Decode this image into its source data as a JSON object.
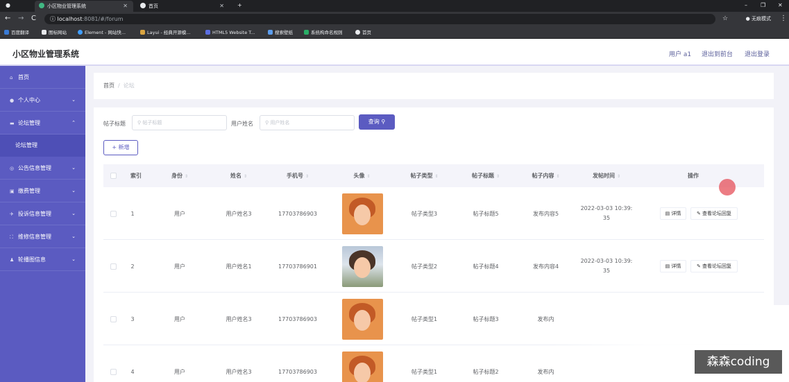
{
  "browser": {
    "tabs": [
      {
        "title": "小区物业管理系统",
        "active": true
      },
      {
        "title": "首页",
        "active": false
      }
    ],
    "url_host": "localhost",
    "url_rest": ":8081/#/forum",
    "incognito_label": "无痕模式",
    "bookmarks": [
      "百度翻译",
      "图标网站",
      "Element - 网站快...",
      "Layui - 经典开源模...",
      "HTML5 Website T...",
      "搜索壁纸",
      "系统构命名规则",
      "首页"
    ]
  },
  "header": {
    "title": "小区物业管理系统",
    "user_label": "用户 a1",
    "to_front_label": "退出到前台",
    "logout_label": "退出登录"
  },
  "sidebar": {
    "items": [
      {
        "label": "首页",
        "icon": "home-icon",
        "arrow": ""
      },
      {
        "label": "个人中心",
        "icon": "user-icon",
        "arrow": "⌄"
      },
      {
        "label": "论坛管理",
        "icon": "chat-icon",
        "arrow": "⌃"
      },
      {
        "label": "公告信息管理",
        "icon": "notice-icon",
        "arrow": "⌄"
      },
      {
        "label": "缴费管理",
        "icon": "payment-icon",
        "arrow": "⌄"
      },
      {
        "label": "投诉信息管理",
        "icon": "complaint-icon",
        "arrow": "⌄"
      },
      {
        "label": "维修信息管理",
        "icon": "repair-icon",
        "arrow": "⌄"
      },
      {
        "label": "轮播图信息",
        "icon": "carousel-icon",
        "arrow": "⌄"
      }
    ],
    "submenu_forum": "论坛管理"
  },
  "breadcrumb": {
    "home": "首页",
    "current": "论坛"
  },
  "filters": {
    "title_label": "帖子标题",
    "title_placeholder": "帖子标题",
    "user_label": "用户姓名",
    "user_placeholder": "用户姓名",
    "search_label": "查询",
    "add_label": "新增"
  },
  "table": {
    "columns": [
      "索引",
      "身份",
      "姓名",
      "手机号",
      "头像",
      "帖子类型",
      "帖子标题",
      "帖子内容",
      "发帖时间",
      "操作"
    ],
    "detail_label": "详情",
    "reply_label": "查看论坛回复",
    "rows": [
      {
        "index": "1",
        "role": "用户",
        "name": "用户姓名3",
        "phone": "17703786903",
        "type": "帖子类型3",
        "title": "帖子标题5",
        "content": "发布内容5",
        "time_a": "2022-03-03 10:39:",
        "time_b": "35",
        "avatar": "orange"
      },
      {
        "index": "2",
        "role": "用户",
        "name": "用户姓名1",
        "phone": "17703786901",
        "type": "帖子类型2",
        "title": "帖子标题4",
        "content": "发布内容4",
        "time_a": "2022-03-03 10:39:",
        "time_b": "35",
        "avatar": "garden"
      },
      {
        "index": "3",
        "role": "用户",
        "name": "用户姓名3",
        "phone": "17703786903",
        "type": "帖子类型1",
        "title": "帖子标题3",
        "content": "发布内",
        "time_a": "",
        "time_b": "",
        "avatar": "orange"
      },
      {
        "index": "4",
        "role": "用户",
        "name": "用户姓名3",
        "phone": "17703786903",
        "type": "帖子类型1",
        "title": "帖子标题2",
        "content": "发布内",
        "time_a": "",
        "time_b": "",
        "avatar": "orange"
      }
    ]
  },
  "watermark": "森森coding"
}
